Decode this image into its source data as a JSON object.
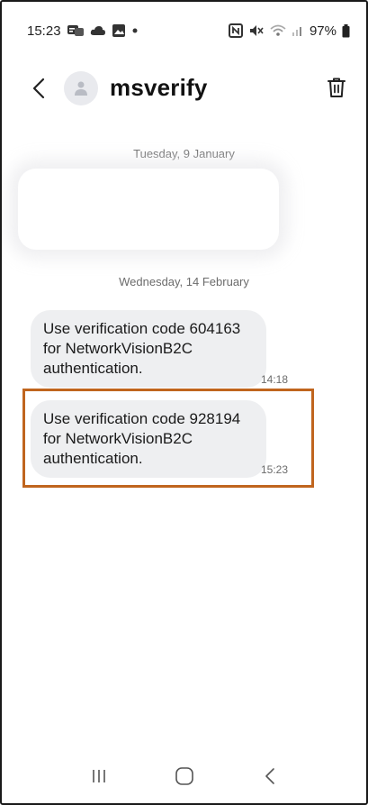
{
  "status_bar": {
    "time": "15:23",
    "battery": "97%",
    "left_icons": [
      "message-notification-icon",
      "cloud-icon",
      "image-icon",
      "dot-icon"
    ],
    "right_icons": [
      "nfc-icon",
      "mute-icon",
      "wifi-icon",
      "signal-icon",
      "battery-icon"
    ]
  },
  "header": {
    "contact_name": "msverify"
  },
  "conversation": {
    "date_1": "Tuesday, 9 January",
    "date_2": "Wednesday, 14 February",
    "messages": [
      {
        "text": "Use verification code 604163\nfor NetworkVisionB2C\nauthentication.",
        "time": "14:18"
      },
      {
        "text": "Use verification code 928194\nfor NetworkVisionB2C\nauthentication.",
        "time": "15:23",
        "highlighted": true
      }
    ]
  },
  "colors": {
    "highlight_border": "#c0651e",
    "bubble_bg": "#eeeff1",
    "secondary_text": "#6b6b6b"
  }
}
